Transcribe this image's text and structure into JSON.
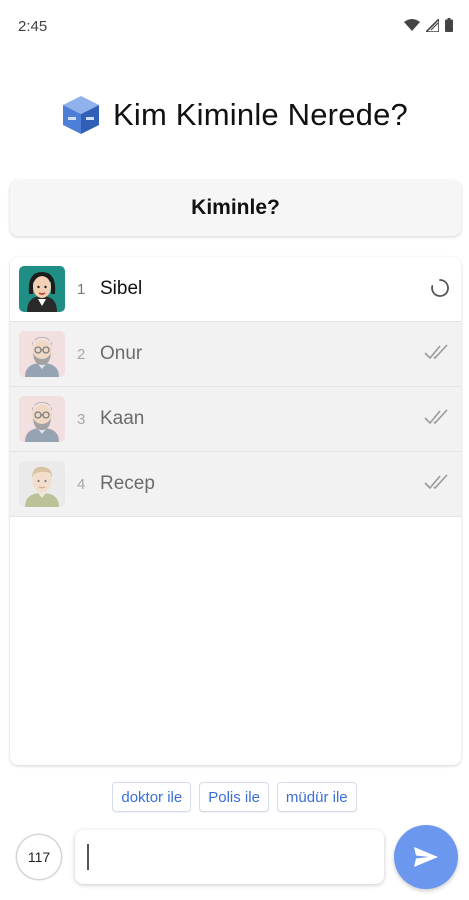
{
  "status_bar": {
    "time": "2:45",
    "icons": [
      "wifi-icon",
      "signal-icon",
      "battery-icon"
    ]
  },
  "app": {
    "title": "Kim Kiminle Nerede?",
    "logo": "cube-logo-icon"
  },
  "header": {
    "title": "Kiminle?"
  },
  "players": [
    {
      "number": "1",
      "name": "Sibel",
      "status": "loading",
      "avatar": "woman-avatar"
    },
    {
      "number": "2",
      "name": "Onur",
      "status": "done",
      "avatar": "bearded-man-glasses-avatar"
    },
    {
      "number": "3",
      "name": "Kaan",
      "status": "done",
      "avatar": "bearded-man-glasses-avatar"
    },
    {
      "number": "4",
      "name": "Recep",
      "status": "done",
      "avatar": "man-avatar"
    }
  ],
  "suggestions": [
    "doktor ile",
    "Polis ile",
    "müdür ile"
  ],
  "input": {
    "value": "",
    "counter": "117"
  },
  "colors": {
    "accent": "#6c97ee",
    "chip_text": "#3a6ed8",
    "avatar_teal": "#1f8f86"
  }
}
